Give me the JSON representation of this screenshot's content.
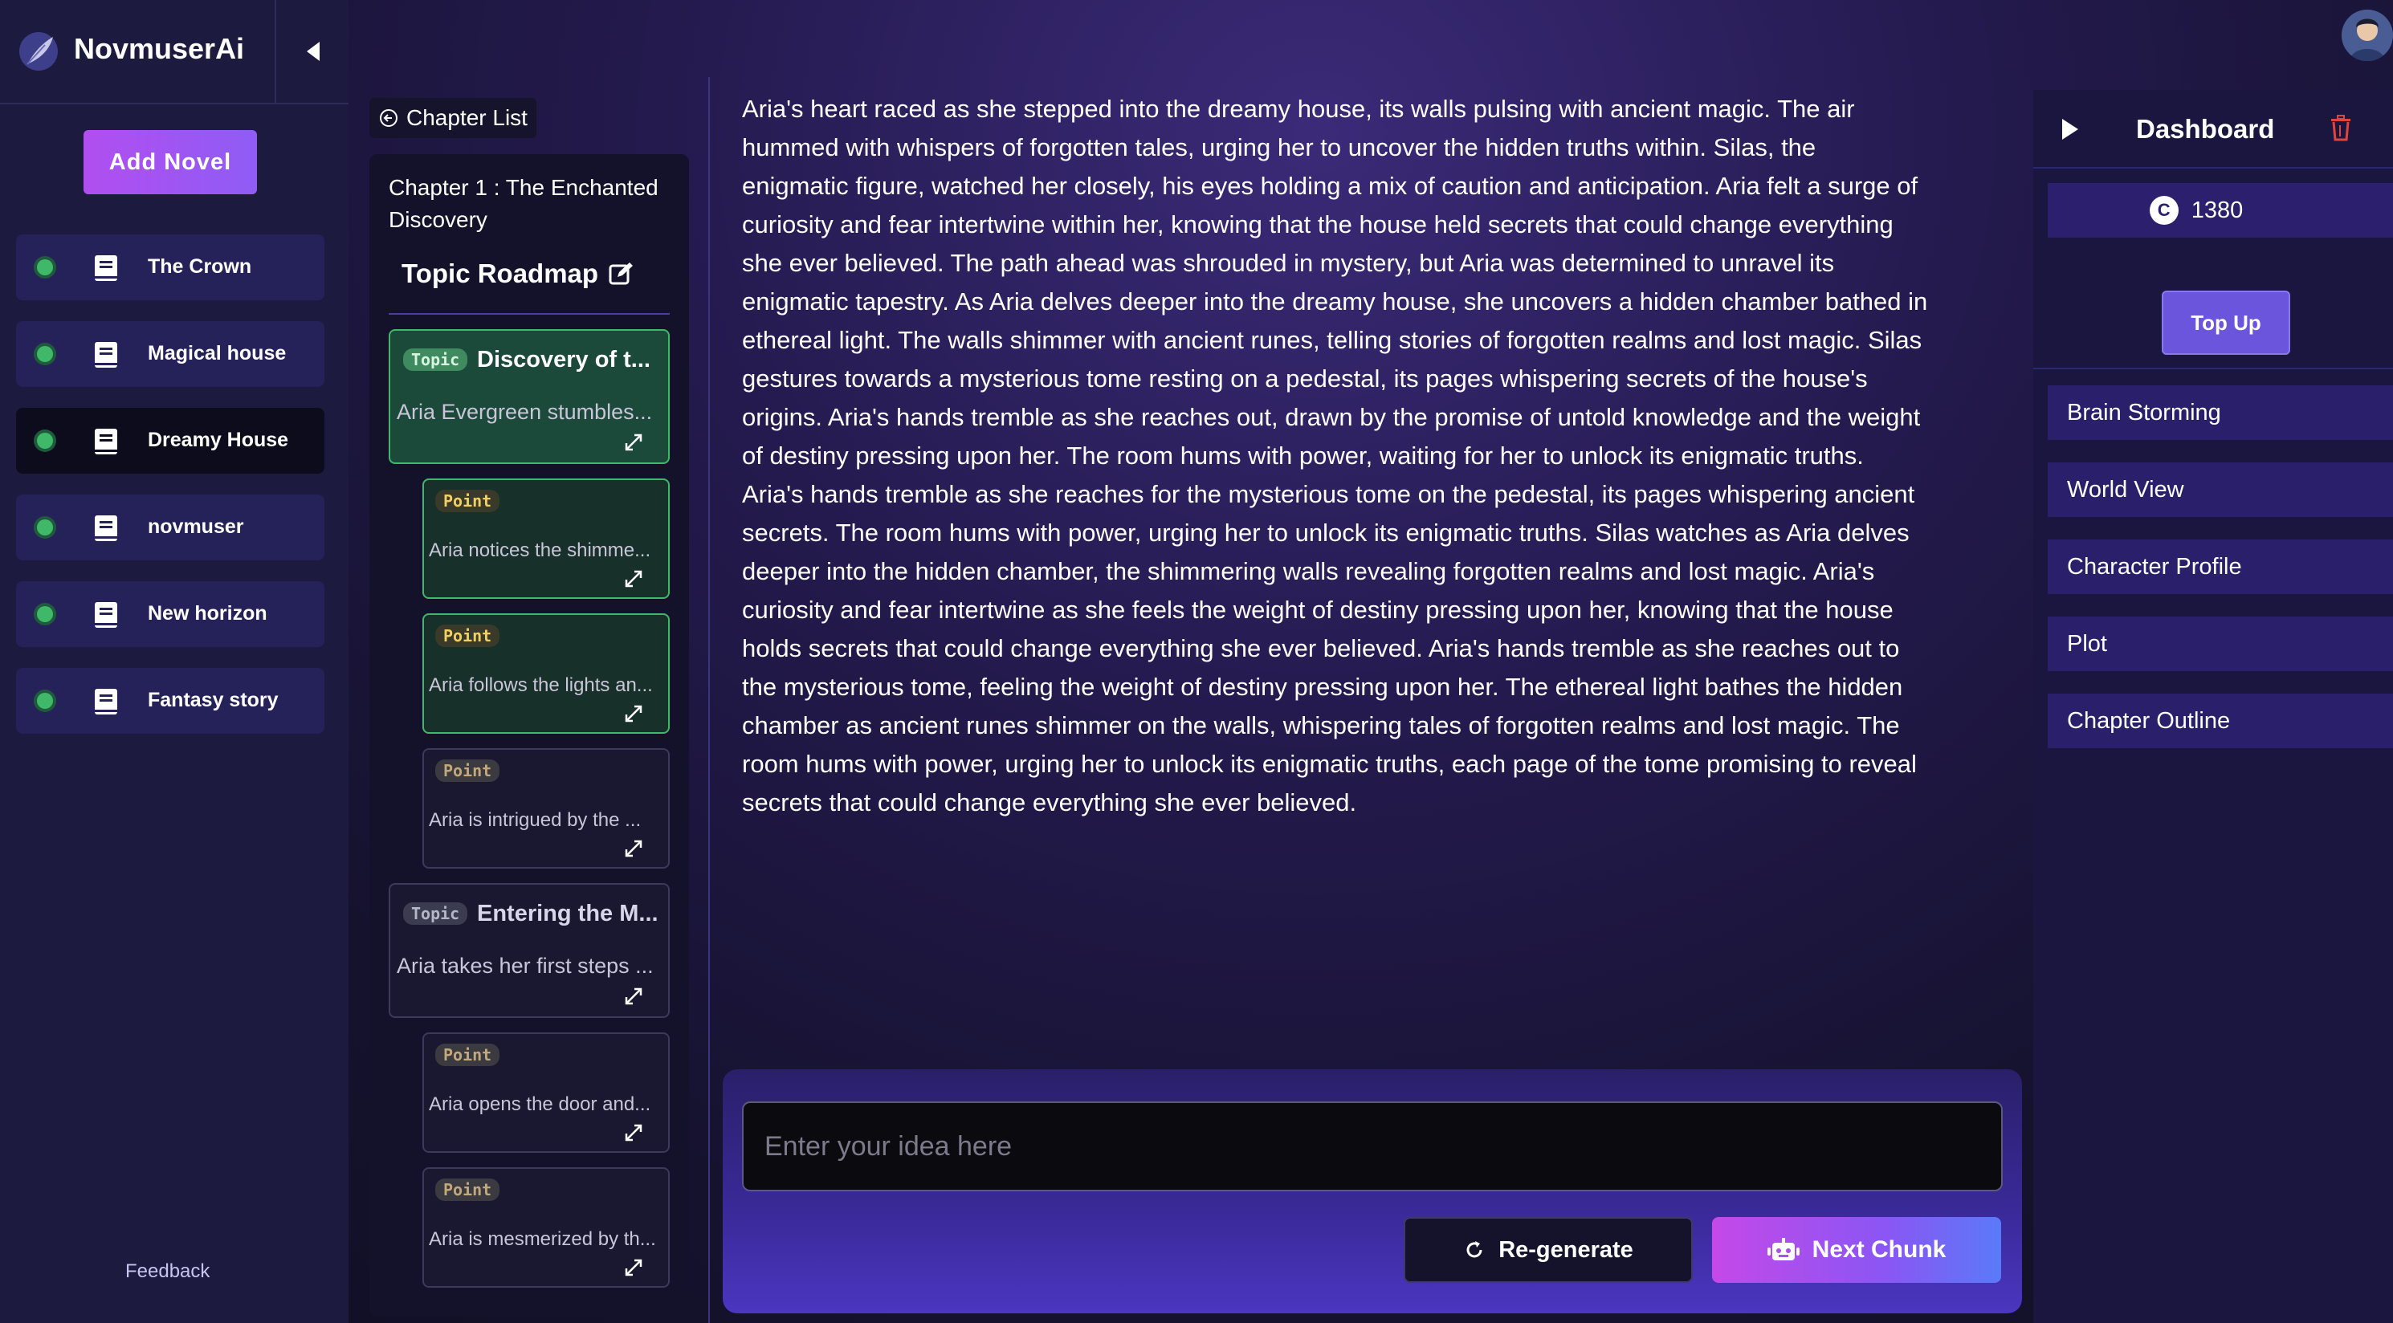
{
  "app": {
    "name": "NovmuserAi"
  },
  "sidebar": {
    "add_novel_label": "Add Novel",
    "novels": [
      {
        "label": "The Crown",
        "active": false
      },
      {
        "label": "Magical house",
        "active": false
      },
      {
        "label": "Dreamy House",
        "active": true
      },
      {
        "label": "novmuser",
        "active": false
      },
      {
        "label": "New horizon",
        "active": false
      },
      {
        "label": "Fantasy story",
        "active": false
      }
    ],
    "feedback_label": "Feedback"
  },
  "chapter_panel": {
    "chapter_list_label": "Chapter List",
    "chapter_title": "Chapter 1 : The Enchanted Discovery",
    "roadmap_title": "Topic Roadmap",
    "cards": [
      {
        "kind": "topic",
        "badge": "Topic",
        "heading": "Discovery of t...",
        "text": "Aria Evergreen stumbles...",
        "active": true
      },
      {
        "kind": "point",
        "badge": "Point",
        "text": "Aria notices the shimme...",
        "active": true
      },
      {
        "kind": "point",
        "badge": "Point",
        "text": "Aria follows the lights an...",
        "active": true
      },
      {
        "kind": "point",
        "badge": "Point",
        "text": "Aria is intrigued by the ...",
        "active": false
      },
      {
        "kind": "topic",
        "badge": "Topic",
        "heading": "Entering the M...",
        "text": "Aria takes her first steps ...",
        "active": false
      },
      {
        "kind": "point",
        "badge": "Point",
        "text": "Aria opens the door and...",
        "active": false
      },
      {
        "kind": "point",
        "badge": "Point",
        "text": "Aria is mesmerized by th...",
        "active": false
      }
    ]
  },
  "main": {
    "story_lines": [
      "Aria's heart raced as she stepped into the dreamy house, its walls pulsing with ancient magic. The air",
      "hummed with whispers of forgotten tales, urging her to uncover the hidden truths within. Silas, the",
      "enigmatic figure, watched her closely, his eyes holding a mix of caution and anticipation. Aria felt a surge of",
      "curiosity and fear intertwine within her, knowing that the house held secrets that could change everything",
      "she ever believed. The path ahead was shrouded in mystery, but Aria was determined to unravel its",
      "enigmatic tapestry.  As Aria delves deeper into the dreamy house, she uncovers a hidden chamber bathed in",
      "ethereal light. The walls shimmer with ancient runes, telling stories of forgotten realms and lost magic. Silas",
      "gestures towards a mysterious tome resting on a pedestal, its pages whispering secrets of the house's",
      "origins. Aria's hands tremble as she reaches out, drawn by the promise of untold knowledge and the weight",
      "of destiny pressing upon her. The room hums with power, waiting for her to unlock its enigmatic truths.",
      "Aria's hands tremble as she reaches for the mysterious tome on the pedestal, its pages whispering ancient",
      "secrets. The room hums with power, urging her to unlock its enigmatic truths. Silas watches as Aria delves",
      "deeper into the hidden chamber, the shimmering walls revealing forgotten realms and lost magic. Aria's",
      "curiosity and fear intertwine as she feels the weight of destiny pressing upon her, knowing that the house",
      "holds secrets that could change everything she ever believed.  Aria's hands tremble as she reaches out to",
      "the mysterious tome, feeling the weight of destiny pressing upon her. The ethereal light bathes the hidden",
      "chamber as ancient runes shimmer on the walls, whispering tales of forgotten realms and lost magic. The",
      "room hums with power, urging her to unlock its enigmatic truths, each page of the tome promising to reveal",
      "secrets that could change everything she ever believed."
    ],
    "input_placeholder": "Enter your idea here",
    "regenerate_label": "Re-generate",
    "next_chunk_label": "Next Chunk"
  },
  "dashboard": {
    "title": "Dashboard",
    "credit_symbol": "C",
    "credits": "1380",
    "top_up_label": "Top Up",
    "menu": [
      "Brain Storming",
      "World View",
      "Character Profile",
      "Plot",
      "Chapter Outline"
    ]
  },
  "colors": {
    "accent_purple": "#8f5cf5",
    "accent_pink": "#b14ef0",
    "active_green": "#3fb86a",
    "trash_red": "#e0443c"
  },
  "icons": {
    "logo": "feather-logo-icon",
    "collapse": "caret-left-icon",
    "novel": "book-icon",
    "chapter_list": "circle-arrow-left-icon",
    "roadmap_edit": "edit-icon",
    "expand": "expand-arrows-icon",
    "regenerate": "refresh-icon",
    "next_chunk": "robot-icon",
    "play": "play-icon",
    "trash": "trash-icon"
  }
}
